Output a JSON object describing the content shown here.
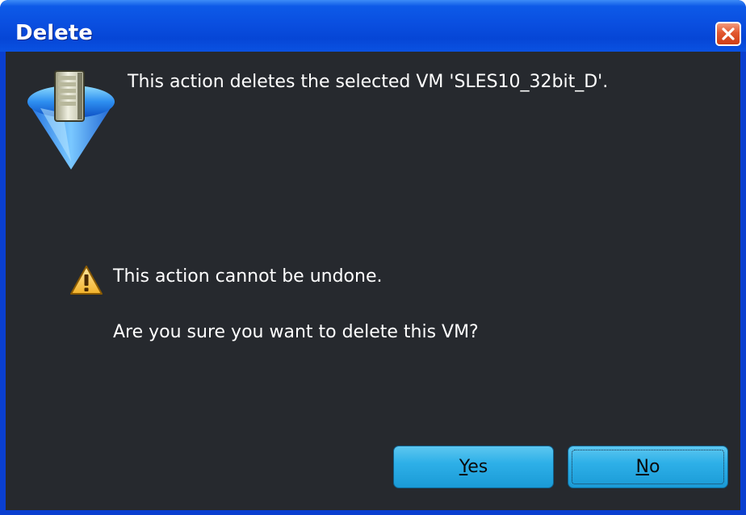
{
  "window": {
    "title": "Delete"
  },
  "dialog": {
    "message": "This action deletes the selected VM 'SLES10_32bit_D'.",
    "warning": "This action cannot be undone.",
    "question": "Are you sure you want to delete this VM?"
  },
  "buttons": {
    "yes_mnemonic": "Y",
    "yes_rest": "es",
    "no_mnemonic": "N",
    "no_rest": "o"
  },
  "icons": {
    "titlebar_close": "close-icon",
    "vm": "virtual-machine-icon",
    "warning": "warning-icon"
  },
  "colors": {
    "titlebar": "#0a4fe0",
    "client_background": "#26292e",
    "button": "#2eb0e8",
    "close_button": "#e2572f",
    "text": "#ffffff"
  }
}
